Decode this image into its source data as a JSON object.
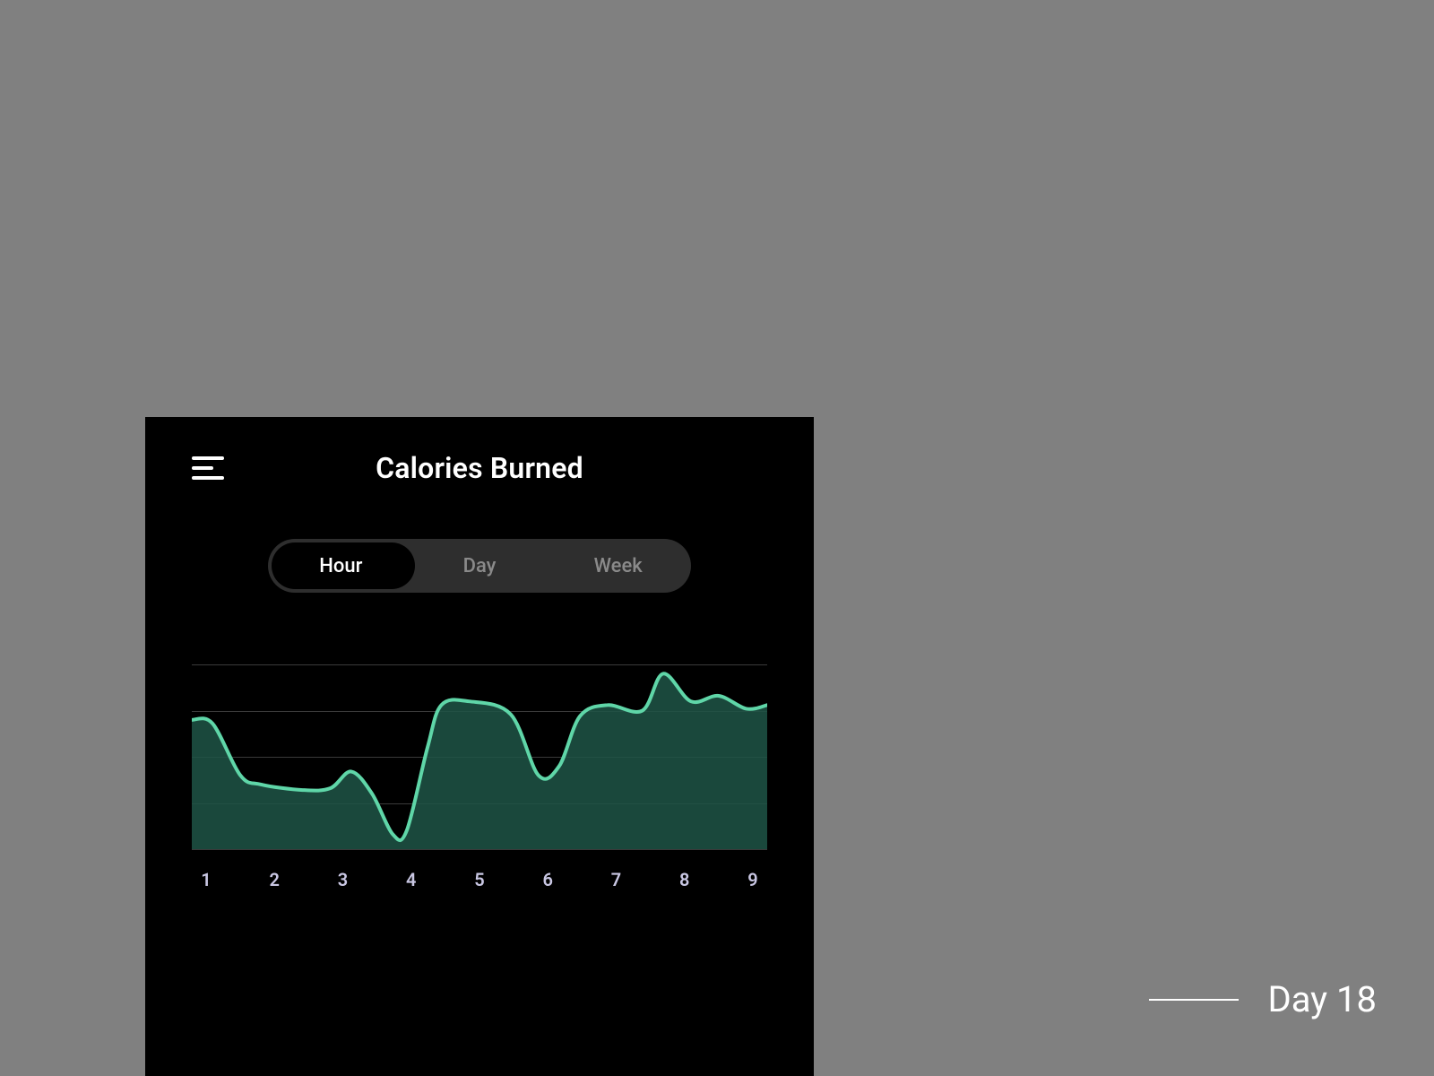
{
  "header": {
    "title": "Calories Burned"
  },
  "segmented": {
    "options": [
      "Hour",
      "Day",
      "Week"
    ],
    "active_index": 0
  },
  "footer": {
    "label": "Day 18"
  },
  "colors": {
    "accent": "#5fd6a8",
    "area": "#1f5546",
    "grid": "#3a3a3a",
    "axis_text": "#c9c7e3"
  },
  "chart_data": {
    "type": "area",
    "title": "Calories Burned",
    "xlabel": "",
    "ylabel": "",
    "ylim": [
      0,
      100
    ],
    "gridlines_y": [
      0,
      25,
      50,
      75,
      100
    ],
    "x": [
      1,
      1.3,
      1.7,
      2,
      2.6,
      3,
      3.3,
      3.6,
      3.9,
      4.1,
      4.4,
      4.6,
      5,
      5.6,
      6,
      6.3,
      6.6,
      7,
      7.5,
      7.8,
      8.2,
      8.6,
      9,
      9.3
    ],
    "y": [
      70,
      68,
      40,
      35,
      32,
      33,
      42,
      30,
      8,
      10,
      55,
      78,
      80,
      73,
      40,
      45,
      72,
      78,
      75,
      95,
      80,
      83,
      76,
      78
    ],
    "categories": [
      "1",
      "2",
      "3",
      "4",
      "5",
      "6",
      "7",
      "8",
      "9"
    ]
  }
}
